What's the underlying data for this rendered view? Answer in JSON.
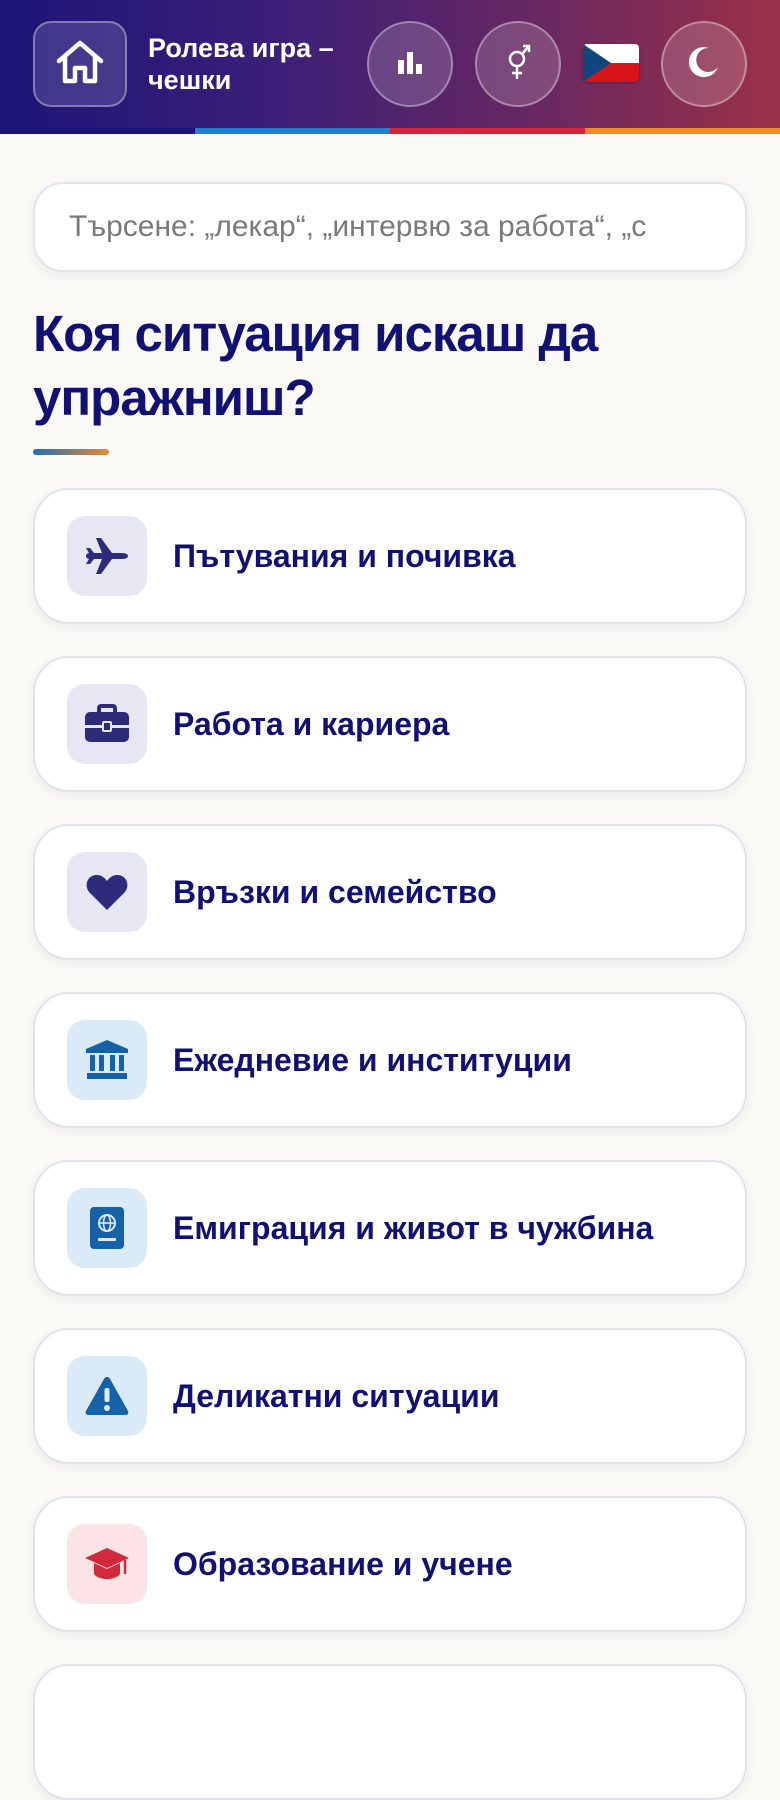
{
  "header": {
    "title": "Ролева игра – чешки",
    "flag_country": "Czech Republic",
    "buttons": [
      "home-icon",
      "stats-icon",
      "gender-icon",
      "moon-icon"
    ],
    "stripe_colors": [
      "#1c1578",
      "#1f7fd1",
      "#d8233a",
      "#f08a24"
    ]
  },
  "search": {
    "placeholder": "Търсене: „лекар“, „интервю за работа“, „с"
  },
  "main": {
    "heading": "Коя ситуация искаш да упражниш?",
    "categories": [
      {
        "label": "Пътувания и почивка",
        "icon": "airplane-icon",
        "bg": "#e7e6f3",
        "fg": "#2c2c7a"
      },
      {
        "label": "Работа и кариера",
        "icon": "briefcase-icon",
        "bg": "#e7e6f3",
        "fg": "#2c2c7a"
      },
      {
        "label": "Връзки и семейство",
        "icon": "heart-icon",
        "bg": "#e7e6f3",
        "fg": "#2c2c7a"
      },
      {
        "label": "Ежедневие и институции",
        "icon": "institution-icon",
        "bg": "#dbeaf7",
        "fg": "#1562a8"
      },
      {
        "label": "Емиграция и живот в чужбина",
        "icon": "passport-icon",
        "bg": "#dbeaf7",
        "fg": "#1562a8"
      },
      {
        "label": "Деликатни ситуации",
        "icon": "warning-icon",
        "bg": "#dbeaf7",
        "fg": "#1562a8"
      },
      {
        "label": "Образование и учене",
        "icon": "graduation-cap-icon",
        "bg": "#fbe3e6",
        "fg": "#d22a3c"
      }
    ]
  }
}
